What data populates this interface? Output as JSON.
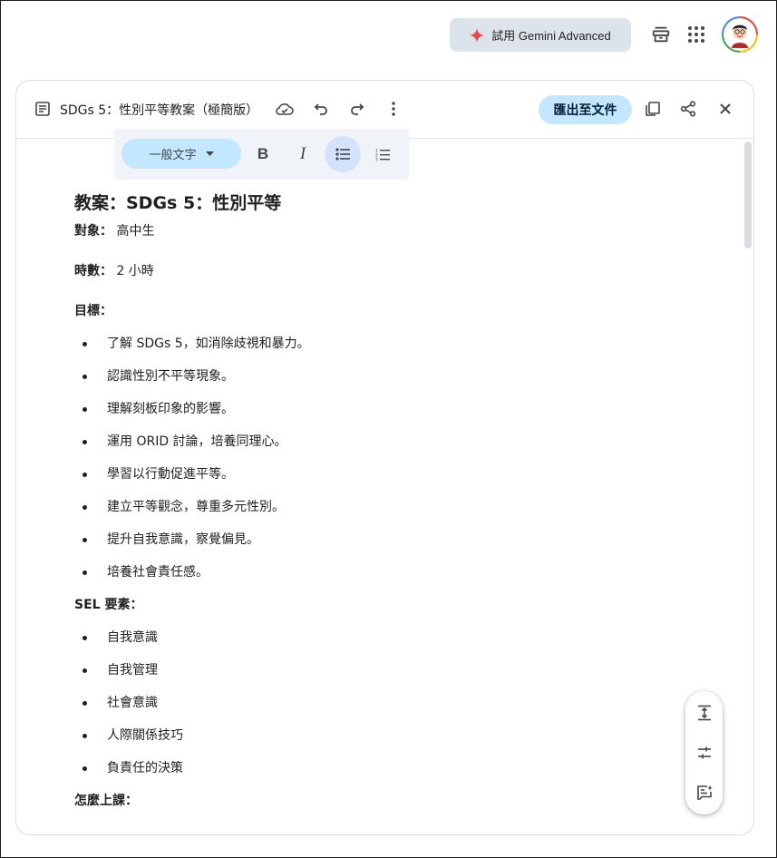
{
  "top_bar": {
    "gemini_label": "試用 Gemini Advanced",
    "avatar_caption": "Teacher"
  },
  "canvas": {
    "title": "SDGs 5：性別平等教案（極簡版）",
    "export_label": "匯出至文件",
    "style_select": "一般文字",
    "bold_label": "B",
    "italic_label": "I"
  },
  "document": {
    "heading": "教案：SDGs 5：性別平等",
    "audience_label": "對象：",
    "audience_value": " 高中生",
    "hours_label": "時數：",
    "hours_value": " 2 小時",
    "goals_title": "目標：",
    "goals": [
      "了解 SDGs 5，如消除歧視和暴力。",
      "認識性別不平等現象。",
      "理解刻板印象的影響。",
      "運用 ORID 討論，培養同理心。",
      "學習以行動促進平等。",
      "建立平等觀念，尊重多元性別。",
      "提升自我意識，察覺偏見。",
      "培養社會責任感。"
    ],
    "sel_title": "SEL 要素：",
    "sel_items": [
      "自我意識",
      "自我管理",
      "社會意識",
      "人際關係技巧",
      "負責任的決策"
    ],
    "how_title": "怎麼上課："
  },
  "colors": {
    "accent_blue": "#c2e7ff",
    "gemini_spark": "#e8484f",
    "toolbar_bg": "#f0f4f9",
    "gemini_btn_bg": "#dde3ea"
  }
}
